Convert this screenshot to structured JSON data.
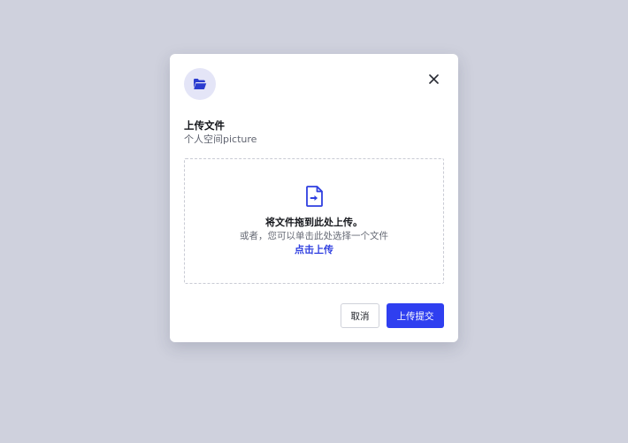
{
  "modal": {
    "header_icon": "folder-open-icon",
    "close_icon": "close-icon",
    "title": "上传文件",
    "subtitle": "个人空间picture"
  },
  "dropzone": {
    "icon": "file-upload-icon",
    "main_text": "将文件拖到此处上传。",
    "sub_text": "或者，您可以单击此处选择一个文件",
    "link_text": "点击上传"
  },
  "footer": {
    "cancel_label": "取消",
    "submit_label": "上传提交"
  },
  "colors": {
    "backdrop": "#cfd1dd",
    "accent": "#2f3ff0",
    "badge_bg": "#e4e5f7"
  }
}
